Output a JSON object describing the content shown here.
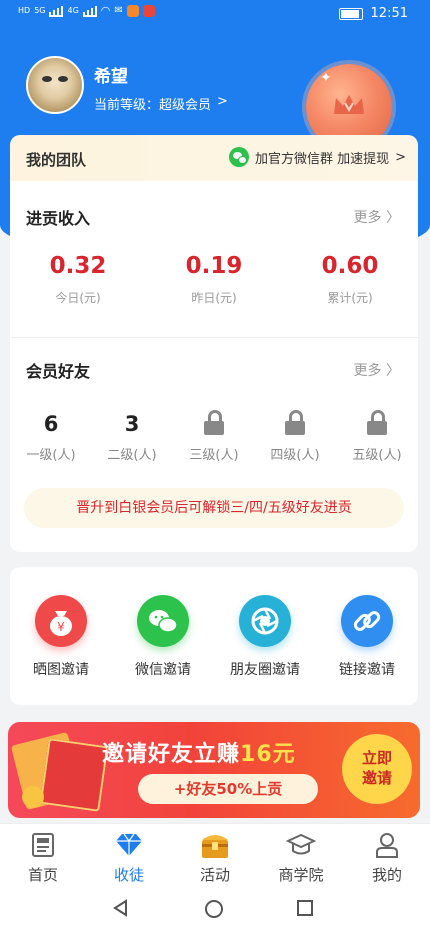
{
  "status_bar": {
    "left_labels": [
      "HD",
      "5G",
      "4G",
      "HD"
    ],
    "time": "12:51"
  },
  "profile": {
    "name": "希望",
    "level_label": "当前等级：",
    "level_value": "超级会员",
    "level_arrow": ">"
  },
  "team": {
    "title": "我的团队",
    "link_text": "加官方微信群 加速提现",
    "link_arrow": ">"
  },
  "income": {
    "title": "进贡收入",
    "more": "更多",
    "stats": [
      {
        "value": "0.32",
        "label": "今日(元)"
      },
      {
        "value": "0.19",
        "label": "昨日(元)"
      },
      {
        "value": "0.60",
        "label": "累计(元)"
      }
    ]
  },
  "friends": {
    "title": "会员好友",
    "more": "更多",
    "levels": [
      {
        "value": "6",
        "label": "一级(人)",
        "locked": false
      },
      {
        "value": "3",
        "label": "二级(人)",
        "locked": false
      },
      {
        "value": "",
        "label": "三级(人)",
        "locked": true
      },
      {
        "value": "",
        "label": "四级(人)",
        "locked": true
      },
      {
        "value": "",
        "label": "五级(人)",
        "locked": true
      }
    ],
    "upgrade_notice": "晋升到白银会员后可解锁三/四/五级好友进贡"
  },
  "invite": {
    "items": [
      {
        "label": "晒图邀请",
        "icon": "money-bag-icon",
        "color": "#f0494a"
      },
      {
        "label": "微信邀请",
        "icon": "wechat-icon",
        "color": "#2dc24b"
      },
      {
        "label": "朋友圈邀请",
        "icon": "aperture-icon",
        "color": "#27b1d6"
      },
      {
        "label": "链接邀请",
        "icon": "link-icon",
        "color": "#2f8ef0"
      }
    ]
  },
  "banner": {
    "title_prefix": "邀请好友立赚",
    "title_amount": "16元",
    "subtitle": "+好友50%上贡",
    "button_line1": "立即",
    "button_line2": "邀请"
  },
  "tabbar": {
    "items": [
      {
        "label": "首页",
        "icon": "news-icon",
        "active": false
      },
      {
        "label": "收徒",
        "icon": "diamond-icon",
        "active": true
      },
      {
        "label": "活动",
        "icon": "treasure-chest-icon",
        "active": false
      },
      {
        "label": "商学院",
        "icon": "graduation-cap-icon",
        "active": false
      },
      {
        "label": "我的",
        "icon": "user-icon",
        "active": false
      }
    ]
  },
  "colors": {
    "primary_blue": "#1e7ef0",
    "income_red": "#d9252d",
    "wechat_green": "#2dc24b"
  }
}
